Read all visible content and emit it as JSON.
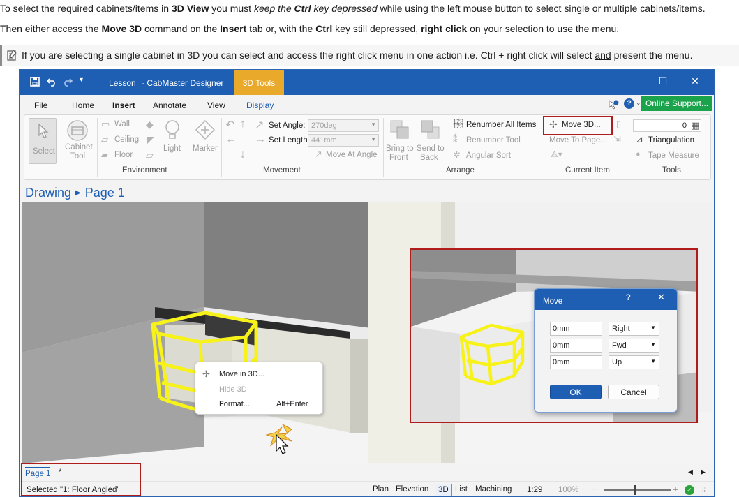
{
  "doc": {
    "line1": {
      "p1": "To select the required cabinets/items in ",
      "b1": "3D View",
      "p2": " you must ",
      "i1": "keep the ",
      "b2": "Ctrl",
      "i2": " key depressed",
      "p3": " while using the left mouse button to select single or multiple cabinets/items."
    },
    "line2": {
      "p1": "Then either access the ",
      "b1": "Move 3D",
      "p2": " command on the ",
      "b2": "Insert",
      "p3": " tab or, with the ",
      "b3": "Ctrl",
      "p4": " key still depressed, ",
      "b4": "right click",
      "p5": " on your selection to use the menu."
    },
    "note": {
      "p1": "If you are selecting a single cabinet in 3D you can select and access the right click menu in one action i.e. Ctrl + right click will select ",
      "u1": "and",
      "p2": " present the menu."
    }
  },
  "window": {
    "doc_title": "Lesson",
    "app_title": "- CabMaster Designer",
    "tools_tab": "3D Tools",
    "online_support": "Online Support..."
  },
  "menu": [
    "File",
    "Home",
    "Insert",
    "Annotate",
    "View",
    "Display"
  ],
  "ribbon": {
    "select": "Select",
    "cabinet_tool": [
      "Cabinet",
      "Tool"
    ],
    "wall": "Wall",
    "ceiling": "Ceiling",
    "floor": "Floor",
    "light": "Light",
    "marker": "Marker",
    "set_angle": "Set Angle:",
    "set_angle_value": "270deg",
    "set_length": "Set Length:",
    "set_length_value": "441mm",
    "move_at_angle": "Move At Angle",
    "bring_to_front": [
      "Bring to",
      "Front"
    ],
    "send_to_back": [
      "Send to",
      "Back"
    ],
    "renumber_all": "Renumber All Items",
    "renumber_tool": "Renumber Tool",
    "angular_sort": "Angular Sort",
    "move_3d": "Move 3D...",
    "move_to_page": "Move To Page...",
    "number_value": "0",
    "triangulation": "Triangulation",
    "tape_measure": "Tape Measure",
    "groups": {
      "environment": "Environment",
      "movement": "Movement",
      "arrange": "Arrange",
      "current_item": "Current Item",
      "tools": "Tools"
    }
  },
  "breadcrumb": {
    "root": "Drawing",
    "page": "Page 1"
  },
  "context_menu": [
    {
      "label": "Move in 3D...",
      "shortcut": "",
      "enabled": true
    },
    {
      "label": "Hide 3D",
      "shortcut": "",
      "enabled": false
    },
    {
      "label": "Format...",
      "shortcut": "Alt+Enter",
      "enabled": true
    }
  ],
  "move_dialog": {
    "title": "Move",
    "help": "?",
    "rows": [
      {
        "value": "0mm",
        "direction": "Right"
      },
      {
        "value": "0mm",
        "direction": "Fwd"
      },
      {
        "value": "0mm",
        "direction": "Up"
      }
    ],
    "ok": "OK",
    "cancel": "Cancel"
  },
  "page_tabs": {
    "page": "Page 1",
    "modified": "*"
  },
  "status": {
    "selected": "Selected \"1: Floor Angled\"",
    "views": [
      "Plan",
      "Elevation",
      "3D",
      "List",
      "Machining"
    ],
    "active_view": "3D",
    "scale": "1:29",
    "zoom": "100%",
    "zoom_minus": "−",
    "zoom_plus": "+"
  },
  "colors": {
    "accent": "#1f5fb3",
    "tools_tab": "#e9a92b",
    "online": "#1aa34a",
    "highlight": "#b01c1c",
    "selection": "#f7f21a"
  }
}
